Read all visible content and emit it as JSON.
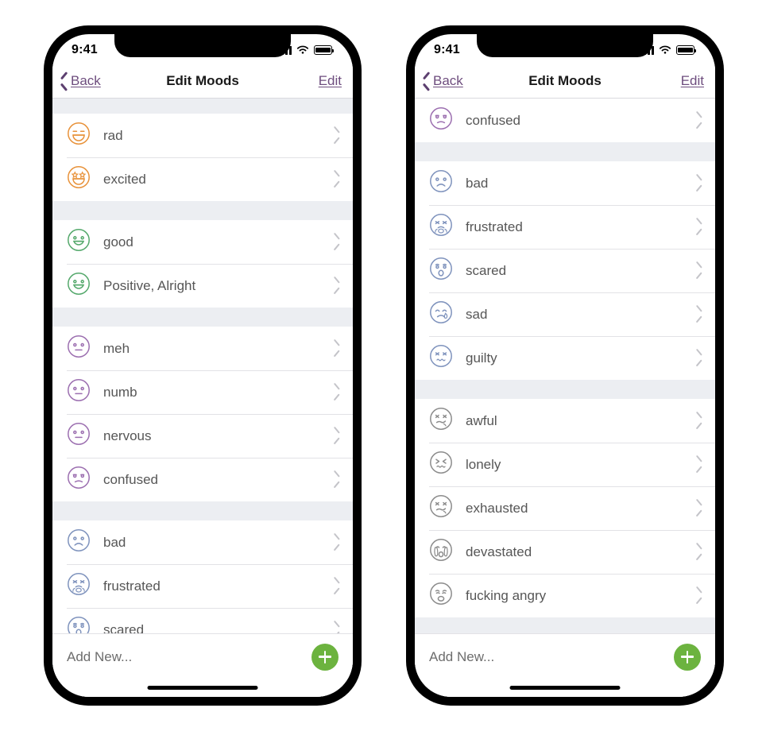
{
  "accent": {
    "nav_purple": "#6e4d7e",
    "add_green": "#6cb33f",
    "section_gap": "#eceef2",
    "row_text": "#565656",
    "rad_color": "#e8923a",
    "good_color": "#54a86b",
    "meh_color": "#9c6fb0",
    "bad_color": "#7f93bd",
    "awful_color": "#8c8c8c"
  },
  "status_bar": {
    "time": "9:41",
    "signal_icon": "cellular-bars-icon",
    "wifi_icon": "wifi-icon",
    "battery_icon": "battery-full-icon"
  },
  "nav": {
    "back_label": "Back",
    "back_icon": "chevron-left-icon",
    "title": "Edit Moods",
    "edit_label": "Edit"
  },
  "footer": {
    "add_new_label": "Add New...",
    "add_icon": "plus-icon"
  },
  "screens": [
    {
      "id": "left",
      "name": "edit-moods-top",
      "sections": [
        {
          "gap": "top-cut",
          "rows": [
            {
              "label": "rad",
              "mood": "rad",
              "color": "#e8923a"
            },
            {
              "label": "excited",
              "mood": "excited",
              "color": "#e8923a"
            }
          ]
        },
        {
          "gap": "mid",
          "rows": [
            {
              "label": "good",
              "mood": "good",
              "color": "#54a86b"
            },
            {
              "label": "Positive, Alright",
              "mood": "good",
              "color": "#54a86b"
            }
          ]
        },
        {
          "gap": "mid",
          "rows": [
            {
              "label": "meh",
              "mood": "meh",
              "color": "#9c6fb0"
            },
            {
              "label": "numb",
              "mood": "meh",
              "color": "#9c6fb0"
            },
            {
              "label": "nervous",
              "mood": "meh",
              "color": "#9c6fb0"
            },
            {
              "label": "confused",
              "mood": "confused",
              "color": "#9c6fb0"
            }
          ]
        },
        {
          "gap": "mid",
          "rows": [
            {
              "label": "bad",
              "mood": "bad",
              "color": "#7f93bd"
            },
            {
              "label": "frustrated",
              "mood": "frustrated",
              "color": "#7f93bd"
            },
            {
              "label": "scared",
              "mood": "scared",
              "color": "#7f93bd"
            }
          ]
        }
      ]
    },
    {
      "id": "right",
      "name": "edit-moods-bottom",
      "sections": [
        {
          "gap": "none",
          "rows": [
            {
              "label": "confused",
              "mood": "confused",
              "color": "#9c6fb0"
            }
          ]
        },
        {
          "gap": "mid",
          "rows": [
            {
              "label": "bad",
              "mood": "bad",
              "color": "#7f93bd"
            },
            {
              "label": "frustrated",
              "mood": "frustrated",
              "color": "#7f93bd"
            },
            {
              "label": "scared",
              "mood": "scared",
              "color": "#7f93bd"
            },
            {
              "label": "sad",
              "mood": "sad",
              "color": "#7f93bd"
            },
            {
              "label": "guilty",
              "mood": "guilty",
              "color": "#7f93bd"
            }
          ]
        },
        {
          "gap": "mid",
          "rows": [
            {
              "label": "awful",
              "mood": "awful",
              "color": "#8c8c8c"
            },
            {
              "label": "lonely",
              "mood": "lonely",
              "color": "#8c8c8c"
            },
            {
              "label": "exhausted",
              "mood": "exhausted",
              "color": "#8c8c8c"
            },
            {
              "label": "devastated",
              "mood": "devastated",
              "color": "#8c8c8c"
            },
            {
              "label": "fucking angry",
              "mood": "angry",
              "color": "#8c8c8c"
            }
          ]
        },
        {
          "gap": "tall",
          "rows": []
        }
      ]
    }
  ]
}
